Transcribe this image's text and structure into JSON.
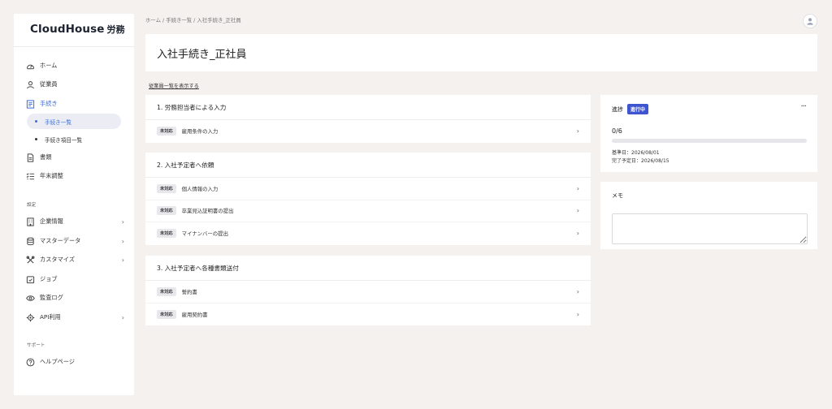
{
  "app": {
    "logo": "CloudHouse",
    "logo_suffix": "労務"
  },
  "sidebar": {
    "main_items": [
      {
        "label": "ホーム",
        "icon": "dashboard-icon"
      },
      {
        "label": "従業員",
        "icon": "user-icon"
      },
      {
        "label": "手続き",
        "icon": "document-list-icon"
      },
      {
        "label": "書類",
        "icon": "file-icon"
      },
      {
        "label": "年末調整",
        "icon": "checklist-icon"
      }
    ],
    "sub_items": [
      {
        "label": "手続き一覧"
      },
      {
        "label": "手続き項目一覧"
      }
    ],
    "settings_label": "設定",
    "settings_items": [
      {
        "label": "企業情報",
        "icon": "building-icon"
      },
      {
        "label": "マスターデータ",
        "icon": "database-icon"
      },
      {
        "label": "カスタマイズ",
        "icon": "tools-icon"
      },
      {
        "label": "ジョブ",
        "icon": "job-icon"
      },
      {
        "label": "監査ログ",
        "icon": "eye-icon"
      },
      {
        "label": "API利用",
        "icon": "api-gear-icon"
      }
    ],
    "support_label": "サポート",
    "support_items": [
      {
        "label": "ヘルプページ",
        "icon": "help-icon"
      }
    ]
  },
  "breadcrumb": "ホーム / 手続き一覧 / 入社手続き_正社員",
  "page": {
    "title": "入社手続き_正社員",
    "employee_link": "従業員一覧を表示する"
  },
  "sections": [
    {
      "title": "1. 労務担当者による入力",
      "rows": [
        {
          "badge": "未対応",
          "label": "雇用条件の入力"
        }
      ]
    },
    {
      "title": "2. 入社予定者へ依頼",
      "rows": [
        {
          "badge": "未対応",
          "label": "個人情報の入力"
        },
        {
          "badge": "未対応",
          "label": "卒業見込証明書の提出"
        },
        {
          "badge": "未対応",
          "label": "マイナンバーの提出"
        }
      ]
    },
    {
      "title": "3. 入社予定者へ各種書類送付",
      "rows": [
        {
          "badge": "未対応",
          "label": "誓約書"
        },
        {
          "badge": "未対応",
          "label": "雇用契約書"
        }
      ]
    }
  ],
  "progress": {
    "label": "進捗",
    "status": "進行中",
    "count": "0/6",
    "fraction": 0,
    "base_date": "基準日：2026/08/01",
    "due_date": "完了予定日：2026/08/15",
    "more": "···"
  },
  "memo": {
    "label": "メモ",
    "value": ""
  },
  "colors": {
    "accent": "#3f55d0",
    "active_nav": "#3b6fd8",
    "background": "#f4f1ee"
  }
}
